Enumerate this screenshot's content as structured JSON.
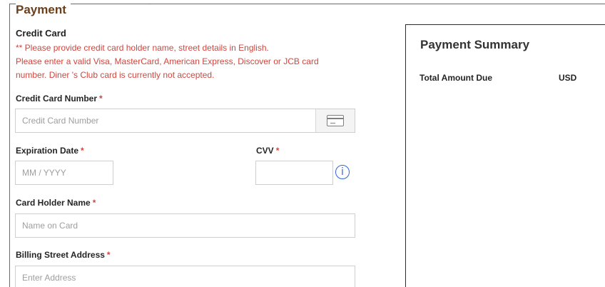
{
  "page": {
    "title": "Payment",
    "top_fragment": "…"
  },
  "credit_card": {
    "section_title": "Credit Card",
    "notice_lines": [
      "** Please provide credit card holder name, street details in English.",
      "Please enter a valid Visa, MasterCard, American Express, Discover or JCB card",
      "number. Diner 's Club card is currently not accepted."
    ],
    "required_marker": "*",
    "card_number": {
      "label": "Credit Card Number",
      "placeholder": "Credit Card Number",
      "value": "",
      "icon": "credit-card-icon"
    },
    "expiration_date": {
      "label": "Expiration Date",
      "placeholder": "MM / YYYY",
      "value": ""
    },
    "cvv": {
      "label": "CVV",
      "placeholder": "",
      "value": "",
      "info_icon": "info-icon",
      "info_glyph": "i"
    },
    "card_holder_name": {
      "label": "Card Holder Name",
      "placeholder": "Name on Card",
      "value": ""
    },
    "billing_street_address": {
      "label": "Billing Street Address",
      "placeholder": "Enter Address",
      "value": ""
    }
  },
  "summary": {
    "title": "Payment Summary",
    "total_label": "Total Amount Due",
    "currency": "USD"
  },
  "colors": {
    "title_brown": "#6b3f1b",
    "notice_red": "#d0463f",
    "info_blue": "#2e66d9"
  }
}
